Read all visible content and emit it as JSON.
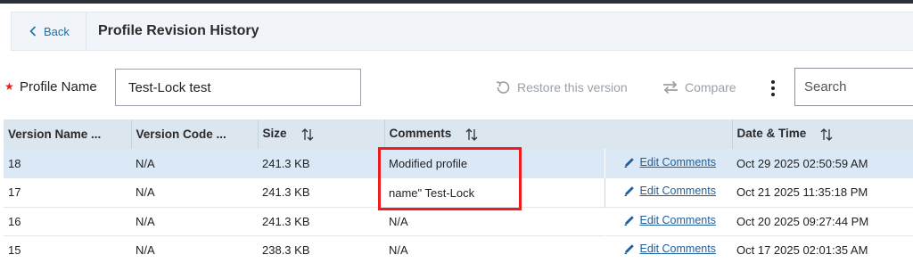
{
  "header": {
    "back_label": "Back",
    "title": "Profile Revision History"
  },
  "profile": {
    "label": "Profile Name",
    "required_mark": "★",
    "value": "Test-Lock test"
  },
  "toolbar": {
    "restore_label": "Restore this version",
    "compare_label": "Compare",
    "search_placeholder": "Search"
  },
  "table": {
    "columns": [
      "Version Name ...",
      "Version Code ...",
      "Size",
      "Comments",
      "",
      "Date & Time"
    ],
    "edit_label": "Edit Comments",
    "rows": [
      {
        "version_name": "18",
        "version_code": "N/A",
        "size": "241.3 KB",
        "comments": "Modified profile",
        "datetime": "Oct 29 2025 02:50:59 AM"
      },
      {
        "version_name": "17",
        "version_code": "N/A",
        "size": "241.3 KB",
        "comments": "name\" Test-Lock",
        "datetime": "Oct 21 2025 11:35:18 PM"
      },
      {
        "version_name": "16",
        "version_code": "N/A",
        "size": "241.3 KB",
        "comments": "N/A",
        "datetime": "Oct 20 2025 09:27:44 PM"
      },
      {
        "version_name": "15",
        "version_code": "N/A",
        "size": "238.3 KB",
        "comments": "N/A",
        "datetime": "Oct 17 2025 02:01:35 AM"
      }
    ]
  },
  "colors": {
    "accent": "#1b6fa8",
    "header_bg": "#dbe6ef",
    "selected_row": "#dbe9f7",
    "highlight": "#ee1c1c"
  },
  "icons": {
    "back": "chevron-left-icon",
    "restore": "restore-icon",
    "compare": "compare-arrows-icon",
    "more": "kebab-menu-icon",
    "sort": "sort-icon",
    "edit": "pencil-icon"
  }
}
